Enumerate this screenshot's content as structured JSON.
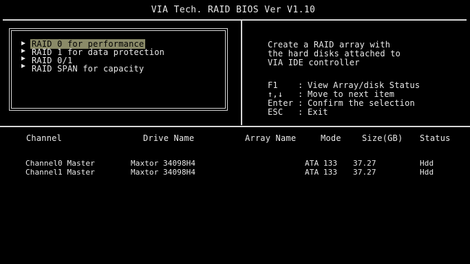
{
  "bios_title": "VIA Tech. RAID BIOS Ver V1.10",
  "menu": {
    "items": [
      {
        "label": "RAID 0 for performance",
        "selected": true
      },
      {
        "label": "RAID 1 for data protection",
        "selected": false
      },
      {
        "label": "RAID 0/1",
        "selected": false
      },
      {
        "label": "RAID SPAN for capacity",
        "selected": false
      }
    ]
  },
  "help": {
    "lines": [
      "Create a RAID array with",
      "the hard disks attached to",
      "VIA IDE controller"
    ],
    "keys": [
      {
        "key": "F1",
        "desc": "View Array/disk Status"
      },
      {
        "key": "↑,↓",
        "desc": "Move to next item"
      },
      {
        "key": "Enter",
        "desc": "Confirm the selection"
      },
      {
        "key": "ESC",
        "desc": "Exit"
      }
    ]
  },
  "table": {
    "headers": [
      "Channel",
      "Drive Name",
      "Array Name",
      "Mode",
      "Size(GB)",
      "Status"
    ],
    "rows": [
      [
        "Channel0 Master",
        "Maxtor 34098H4",
        "",
        "ATA 133",
        "37.27",
        "Hdd"
      ],
      [
        "Channel1 Master",
        "Maxtor 34098H4",
        "",
        "ATA 133",
        "37.27",
        "Hdd"
      ]
    ]
  },
  "colors": {
    "background": "#000000",
    "text": "#e8e8e8",
    "selection": "#8a8a68"
  }
}
